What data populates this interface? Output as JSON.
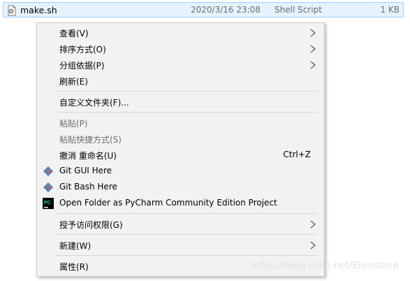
{
  "file": {
    "name": "make.sh",
    "date": "2020/3/16 23:08",
    "type": "Shell Script",
    "size": "1 KB"
  },
  "menu": {
    "view": "查看(V)",
    "sort": "排序方式(O)",
    "group": "分组依据(P)",
    "refresh": "刷新(E)",
    "customize": "自定义文件夹(F)...",
    "paste": "粘贴(P)",
    "paste_shortcut": "粘贴快捷方式(S)",
    "undo": "撤消 重命名(U)",
    "undo_shortcut": "Ctrl+Z",
    "git_gui": "Git GUI Here",
    "git_bash": "Git Bash Here",
    "pycharm": "Open Folder as PyCharm Community Edition Project",
    "grant_access": "授予访问权限(G)",
    "new": "新建(W)",
    "properties": "属性(R)"
  },
  "watermark": "https://blog.csdn.net/Elenstone",
  "icons": {
    "file": "shell-script-file-icon",
    "git_gui": "git-icon",
    "git_bash": "git-icon",
    "pycharm": "pycharm-icon",
    "submenu": "chevron-right-icon"
  },
  "colors": {
    "selection_bg": "#e5f3ff",
    "selection_border": "#99d1ff",
    "menu_bg": "#f2f2f2",
    "disabled_text": "#6d6d6d",
    "git_accent": "#f05033",
    "pycharm_bg": "#000000"
  }
}
